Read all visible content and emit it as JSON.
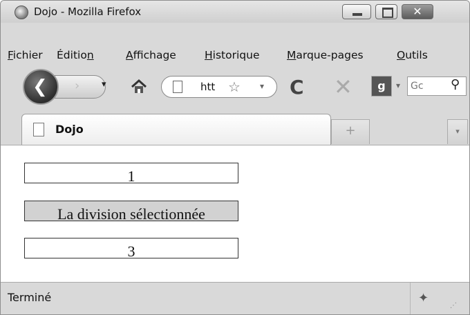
{
  "window": {
    "title": "Dojo - Mozilla Firefox",
    "close_glyph": "✕"
  },
  "menu": [
    {
      "pre": "",
      "key": "F",
      "post": "ichier"
    },
    {
      "pre": "Éditio",
      "key": "n",
      "post": ""
    },
    {
      "pre": "",
      "key": "A",
      "post": "ffichage"
    },
    {
      "pre": "",
      "key": "H",
      "post": "istorique"
    },
    {
      "pre": "",
      "key": "M",
      "post": "arque-pages"
    },
    {
      "pre": "",
      "key": "O",
      "post": "utils"
    }
  ],
  "nav": {
    "back_glyph": "❮",
    "forward_glyph": "›",
    "history_dropdown_glyph": "▾",
    "url_text": "htt",
    "bookmark_star_glyph": "☆",
    "url_dropdown_glyph": "▾",
    "reload_glyph": "C",
    "stop_glyph": "✕",
    "engine_label": "g",
    "engine_dropdown_glyph": "▾",
    "search_placeholder": "Gc",
    "search_glass_glyph": "⚲"
  },
  "tabs": {
    "active_title": "Dojo",
    "new_tab_glyph": "+",
    "list_all_glyph": "▾"
  },
  "content": {
    "divs": [
      {
        "text": "1",
        "selected": false
      },
      {
        "text": "La division sélectionnée",
        "selected": true
      },
      {
        "text": "3",
        "selected": false
      }
    ]
  },
  "status": {
    "text": "Terminé",
    "addon_glyph": "✦",
    "resize_glyph": "⋰"
  },
  "icons": {
    "app": "firefox-logo-icon",
    "back": "back-arrow-icon",
    "forward": "forward-arrow-icon",
    "home": "home-icon",
    "page": "page-icon",
    "bookmark": "star-icon",
    "reload": "reload-icon",
    "stop": "stop-icon",
    "search_engine": "google-icon",
    "search": "search-icon",
    "addon": "addon-icon"
  },
  "colors": {
    "chrome": "#d9d9d9",
    "selected_division": "#d2d2d2",
    "close_button": "#5c5c5c"
  }
}
